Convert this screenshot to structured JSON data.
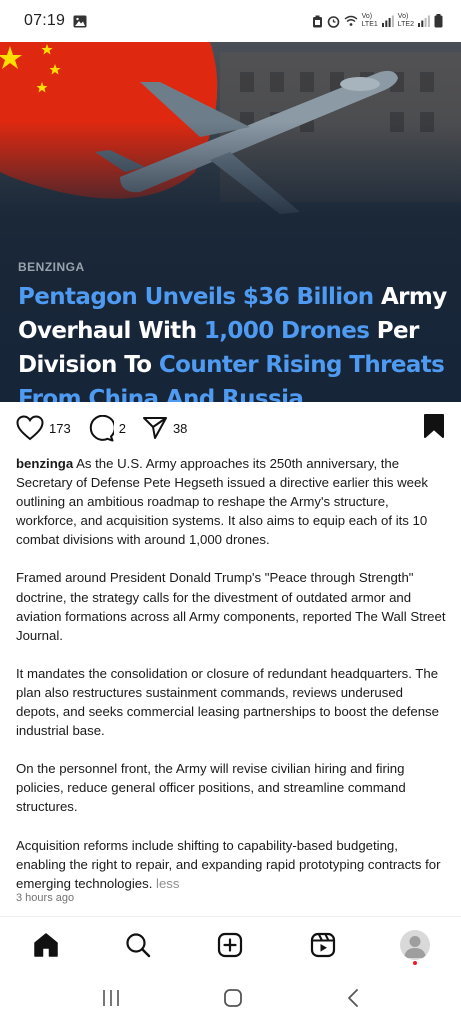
{
  "status_bar": {
    "time": "07:19",
    "sim1": "LTE1",
    "sim2": "LTE2",
    "network": "Vo)",
    "network_type": "4G+"
  },
  "post": {
    "hero": {
      "source": "BENZINGA",
      "title_parts": [
        {
          "text": "Pentagon Unveils $36 Billion",
          "highlight": true
        },
        {
          "text": " Army Overhaul With ",
          "highlight": false
        },
        {
          "text": "1,000 Drones",
          "highlight": true
        },
        {
          "text": " Per Division To ",
          "highlight": false
        },
        {
          "text": "Counter Rising Threats From China And Russia",
          "highlight": true
        }
      ]
    },
    "likes": "173",
    "comments": "2",
    "shares": "38",
    "username": "benzinga",
    "caption_paragraphs": [
      "As the U.S. Army approaches its 250th anniversary, the Secretary of Defense Pete Hegseth issued a directive earlier this week outlining an ambitious roadmap to reshape the Army's structure, workforce, and acquisition systems. It also aims to equip each of its 10 combat divisions with around 1,000 drones.",
      "Framed around President Donald Trump's \"Peace through Strength\" doctrine, the strategy calls for the divestment of outdated armor and aviation formations across all Army components, reported The Wall Street Journal.",
      "It mandates the consolidation or closure of redundant headquarters. The plan also restructures sustainment commands, reviews underused depots, and seeks commercial leasing partnerships to boost the defense industrial base.",
      "On the personnel front, the Army will revise civilian hiring and firing policies, reduce general officer positions, and streamline command structures.",
      "Acquisition reforms include shifting to capability-based budgeting, enabling the right to repair, and expanding rapid prototyping contracts for emerging technologies."
    ],
    "less_label": "less",
    "timestamp": "3 hours ago"
  },
  "colors": {
    "highlight": "#4f9bf2",
    "hero_bg": "#1b2a3e",
    "flag_red": "#de2910",
    "flag_star": "#ffde00"
  },
  "nav": {
    "items": [
      "home-icon",
      "search-icon",
      "create-icon",
      "reels-icon",
      "profile-avatar"
    ]
  }
}
